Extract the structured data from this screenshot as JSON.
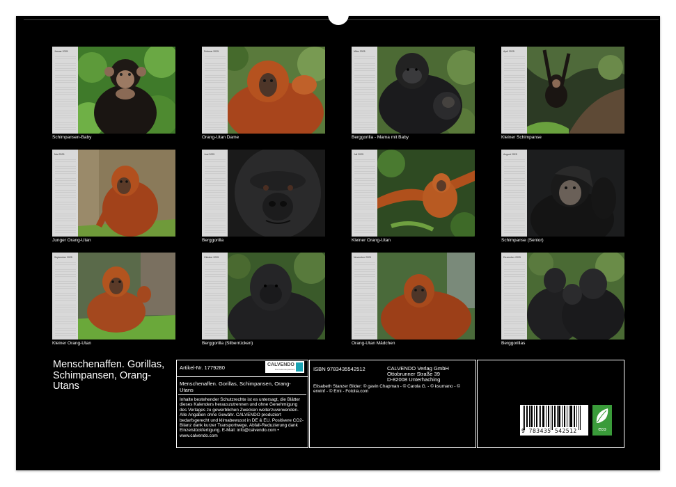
{
  "months": [
    {
      "month_label": "Januar 2025",
      "caption": "Schimpansen-Baby"
    },
    {
      "month_label": "Februar 2025",
      "caption": "Orang-Utan Dame"
    },
    {
      "month_label": "März 2025",
      "caption": "Berggorilla - Mama mit Baby"
    },
    {
      "month_label": "April 2025",
      "caption": "Kleiner Schimpanse"
    },
    {
      "month_label": "Mai 2025",
      "caption": "Junger Orang-Utan"
    },
    {
      "month_label": "Juni 2025",
      "caption": "Berggorilla"
    },
    {
      "month_label": "Juli 2025",
      "caption": "Kleiner Orang-Utan"
    },
    {
      "month_label": "August 2025",
      "caption": "Schimpanse (Senior)"
    },
    {
      "month_label": "September 2025",
      "caption": "Kleiner Orang-Utan"
    },
    {
      "month_label": "Oktober 2025",
      "caption": "Berggorilla (Silberrücken)"
    },
    {
      "month_label": "November 2025",
      "caption": "Orang-Utan Mädchen"
    },
    {
      "month_label": "Dezember 2025",
      "caption": "Berggorillas"
    }
  ],
  "title": "Menschenaffen. Gorillas, Schimpansen, Orang-Utans",
  "info": {
    "article": "Artikel-Nr. 1779280",
    "logo_text": "CALVENDO",
    "logo_sub": "Die Kalenderplattform",
    "short_title": "Menschenaffen. Gorillas, Schimpansen, Orang-Utans",
    "disclaimer": "Inhalte bestehender Schutzrechte ist es untersagt, die Blätter dieses Kalenders herauszutrennen und ohne Genehmigung des Verlages zu gewerblichen Zwecken weiterzuverwenden. Alle Angaben ohne Gewähr. CALVENDO produziert bedarfsgerecht und klimabewusst in DE & EU. Positivere CO2-Bilanz dank kurzer Transportwege. Abfall-Reduzierung dank Einzelstückfertigung. E-Mail: info@calvendo.com • www.calvendo.com",
    "isbn": "ISBN 9783435542512",
    "publisher_name": "CALVENDO Verlag GmbH",
    "publisher_street": "Ottobrunner Straße 39",
    "publisher_city": "D-82008 Unterhaching",
    "credits": "Elisabeth Stanzer Bilder: © gavin Chapman - © Carola G. - © ksumano - © erwinf - © Erni - Fotolia.com",
    "barcode_number": "9 783435 542512",
    "eco_label": "eco"
  },
  "colors": {
    "background": "#000000",
    "eco_green": "#3a9b3a",
    "calvendo_teal": "#1aa3b3"
  }
}
